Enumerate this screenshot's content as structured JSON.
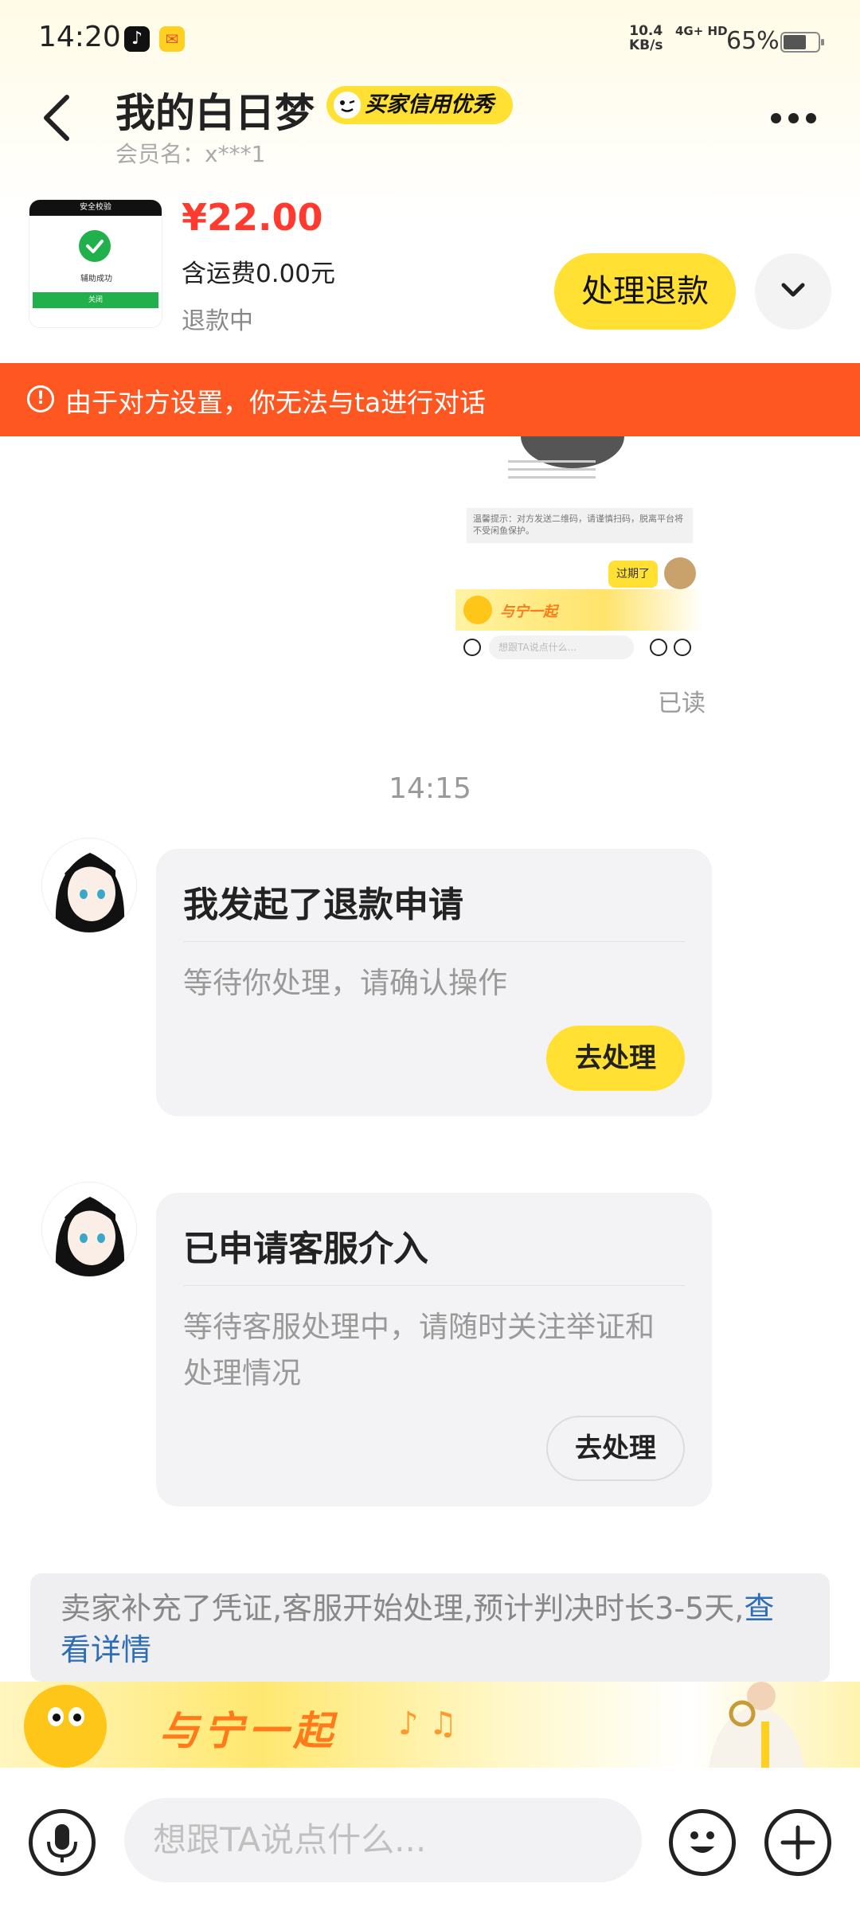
{
  "status_bar": {
    "time": "14:20",
    "net_speed": "10.4",
    "net_unit": "KB/s",
    "signal": "4G+ HD",
    "battery": "65%",
    "battery_level": 0.65
  },
  "header": {
    "title": "我的白日梦",
    "badge": "买家信用优秀",
    "member": "会员名：x***1"
  },
  "product": {
    "thumb_header": "安全校验",
    "thumb_text": "辅助成功",
    "thumb_button": "关闭",
    "price": "¥22.00",
    "shipping": "含运费0.00元",
    "status": "退款中",
    "action_label": "处理退款"
  },
  "banner": {
    "icon": "!",
    "text": "由于对方设置，你无法与ta进行对话"
  },
  "chat_image": {
    "warning": "温馨提示：对方发送二维码，请谨慎扫码，脱离平台将不受闲鱼保护。",
    "expired": "过期了",
    "read_small": "已读",
    "promo": "与宁一起",
    "input_placeholder": "想跟TA说点什么..."
  },
  "read_label": "已读",
  "timestamp": "14:15",
  "cards": [
    {
      "title": "我发起了退款申请",
      "desc": "等待你处理，请确认操作",
      "button": "去处理"
    },
    {
      "title": "已申请客服介入",
      "desc": "等待客服处理中，请随时关注举证和处理情况",
      "button": "去处理"
    }
  ],
  "notice": {
    "text": "卖家补充了凭证,客服开始处理,预计判决时长3-5天,",
    "link": "查看详情"
  },
  "promo": {
    "text": "与宁一起",
    "note": "♪ ♫"
  },
  "input_bar": {
    "placeholder": "想跟TA说点什么..."
  },
  "colors": {
    "accent_yellow": "#ffe033",
    "banner_orange": "#ff5722",
    "price_red": "#ff3b30",
    "link_blue": "#2f6eb5"
  }
}
